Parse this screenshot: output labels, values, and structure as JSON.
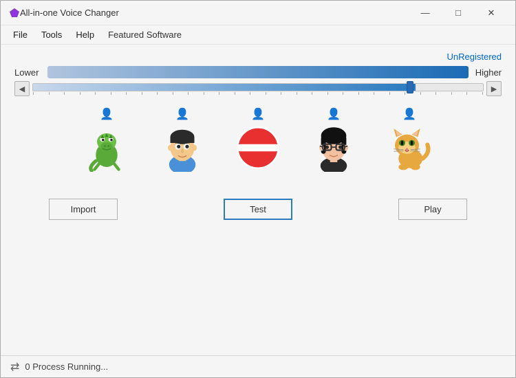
{
  "window": {
    "title": "All-in-one Voice Changer",
    "minimize_label": "—",
    "maximize_label": "□",
    "close_label": "✕"
  },
  "menu": {
    "items": [
      {
        "label": "File",
        "id": "file"
      },
      {
        "label": "Tools",
        "id": "tools"
      },
      {
        "label": "Help",
        "id": "help"
      },
      {
        "label": "Featured Software",
        "id": "featured"
      }
    ]
  },
  "content": {
    "unregistered_label": "UnRegistered",
    "slider": {
      "lower_label": "Lower",
      "higher_label": "Higher",
      "value_percent": 85
    },
    "voices": [
      {
        "id": "dragon",
        "emoji": "🦎",
        "label": "Dragon",
        "selected": false
      },
      {
        "id": "man",
        "emoji": "👨",
        "label": "Man",
        "selected": false
      },
      {
        "id": "none",
        "emoji": "🚫",
        "label": "None",
        "selected": true
      },
      {
        "id": "woman",
        "emoji": "👩",
        "label": "Woman",
        "selected": false
      },
      {
        "id": "cat",
        "emoji": "🐱",
        "label": "Cat",
        "selected": false
      }
    ],
    "buttons": {
      "import_label": "Import",
      "test_label": "Test",
      "play_label": "Play"
    },
    "status": {
      "icon": "⇄",
      "text": "0 Process Running..."
    }
  }
}
